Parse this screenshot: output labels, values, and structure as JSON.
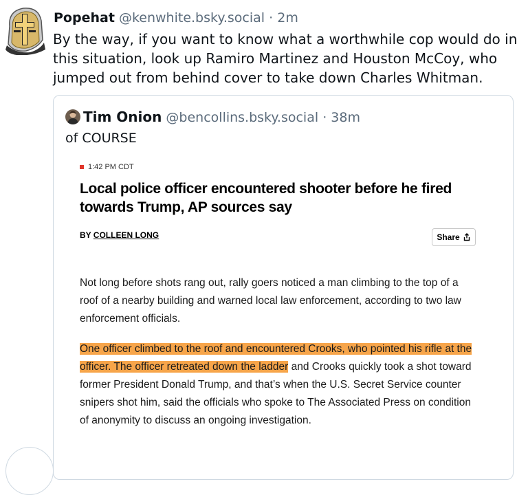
{
  "post": {
    "display_name": "Popehat",
    "handle": "@kenwhite.bsky.social",
    "separator": "·",
    "timestamp": "2m",
    "text": "By the way, if you want to know what a worthwhile cop would do in this situation, look up Ramiro Martinez and Houston McCoy, who jumped out from behind cover to take down Charles Whitman."
  },
  "quote": {
    "display_name": "Tim Onion",
    "handle": "@bencollins.bsky.social",
    "separator": "·",
    "timestamp": "38m",
    "text": "of COURSE"
  },
  "article": {
    "time": "1:42 PM CDT",
    "headline": "Local police officer encountered shooter before he fired towards Trump, AP sources say",
    "byline_prefix": "BY ",
    "author": "COLLEEN LONG",
    "share_label": "Share",
    "paragraph1": "Not long before shots rang out, rally goers noticed a man climbing to the top of a roof of a nearby building and warned local law enforcement, according to two law enforcement officials.",
    "paragraph2_highlight": "One officer climbed to the roof and encountered Crooks, who pointed his rifle at the officer. The officer retreated down the ladder",
    "paragraph2_rest": " and Crooks quickly took a shot toward former President Donald Trump, and that’s when the U.S. Secret Service counter snipers shot him, said the officials who spoke to The Associated Press on condition of anonymity to discuss an ongoing investigation."
  },
  "colors": {
    "highlight": "#f7a54a",
    "handle_gray": "#5b6b7b",
    "card_border": "#cfd9e2",
    "live_red": "#e1362a"
  },
  "icons": {
    "avatar": "popehat-helmet-avatar",
    "quote_avatar": "tim-onion-avatar",
    "share": "share-icon"
  }
}
